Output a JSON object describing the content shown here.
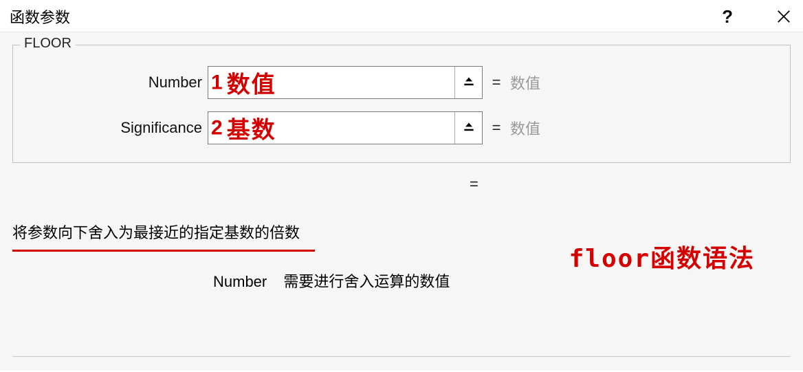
{
  "dialog": {
    "title": "函数参数",
    "help_symbol": "?",
    "close_label": "Close"
  },
  "function": {
    "name": "FLOOR",
    "args": [
      {
        "label": "Number",
        "value": "",
        "hint": "数值",
        "annotation_mark": "1",
        "annotation_text": "数值"
      },
      {
        "label": "Significance",
        "value": "",
        "hint": "数值",
        "annotation_mark": "2",
        "annotation_text": "基数"
      }
    ],
    "result_equals": "=",
    "arg_equals": "=",
    "description": "将参数向下舍入为最接近的指定基数的倍数",
    "current_arg_name": "Number",
    "current_arg_desc": "需要进行舍入运算的数值"
  },
  "annotation": {
    "big_text": "floor函数语法"
  },
  "colors": {
    "annotation_red": "#d40000",
    "hint_gray": "#9a9a9a",
    "panel_bg": "#f6f6f6"
  }
}
